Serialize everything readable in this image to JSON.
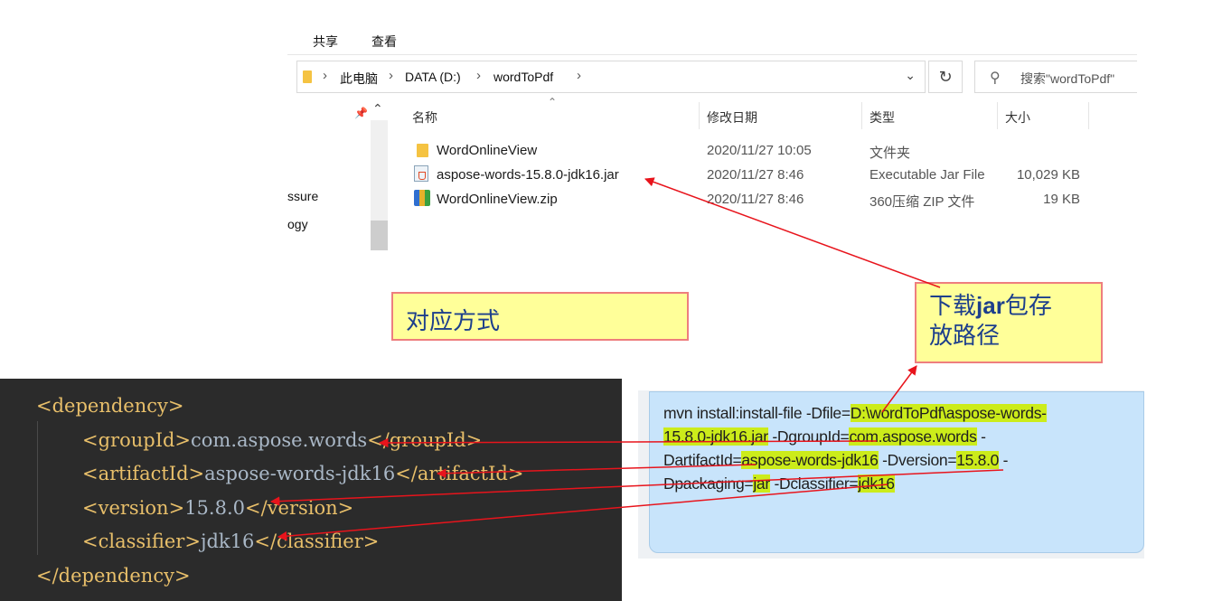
{
  "explorer": {
    "ribbon_tabs": [
      "共享",
      "查看"
    ],
    "address": {
      "crumbs": [
        "此电脑",
        "DATA (D:)",
        "wordToPdf"
      ],
      "search_placeholder": "搜索\"wordToPdf\""
    },
    "nav_items": [
      "ssure",
      "ogy"
    ],
    "columns": {
      "name": "名称",
      "modified": "修改日期",
      "type": "类型",
      "size": "大小"
    },
    "files": [
      {
        "icon": "folder-icon",
        "name": "WordOnlineView",
        "modified": "2020/11/27 10:05",
        "type": "文件夹",
        "size": ""
      },
      {
        "icon": "jar-file-icon",
        "name": "aspose-words-15.8.0-jdk16.jar",
        "modified": "2020/11/27 8:46",
        "type": "Executable Jar File",
        "size": "10,029 KB"
      },
      {
        "icon": "zip-file-icon",
        "name": "WordOnlineView.zip",
        "modified": "2020/11/27 8:46",
        "type": "360压缩 ZIP 文件",
        "size": "19 KB"
      }
    ]
  },
  "callouts": {
    "mapping": "对应方式",
    "jar_path_prefix": "下载",
    "jar_path_bold": "jar",
    "jar_path_suffix": "包存",
    "jar_path_line2": "放路径"
  },
  "code": {
    "open_tag": "<dependency>",
    "close_tag": "</dependency>",
    "lines": [
      {
        "open": "<groupId>",
        "value": "com.aspose.words",
        "close": "</groupId>"
      },
      {
        "open": "<artifactId>",
        "value": "aspose-words-jdk16",
        "close": "</artifactId>"
      },
      {
        "open": "<version>",
        "value": "15.8.0",
        "close": "</version>"
      },
      {
        "open": "<classifier>",
        "value": "jdk16",
        "close": "</classifier>"
      }
    ]
  },
  "command": {
    "l1_a": "mvn install:install-file -Dfile=",
    "l1_hl": "D:\\wordToPdf\\aspose-words-",
    "l2_hl1": "15.8.0-jdk16.jar",
    "l2_b": " -DgroupId=",
    "l2_hl2": "com.aspose.words",
    "l2_c": " -",
    "l3_a": "DartifactId=",
    "l3_hl1": "aspose-words-jdk16",
    "l3_b": " -Dversion=",
    "l3_hl2": "15.8.0",
    "l3_c": " -",
    "l4_a": "Dpackaging=",
    "l4_hl1": "jar",
    "l4_b": " -Dclassifier=",
    "l4_hl2": "jdk16"
  },
  "colors": {
    "arrow": "#e8141c",
    "callout_fill": "#ffff99",
    "callout_border": "#ee7e7e",
    "highlight": "#ccec1a",
    "code_bg": "#2b2b2b",
    "command_bg": "#c8e4fb"
  }
}
